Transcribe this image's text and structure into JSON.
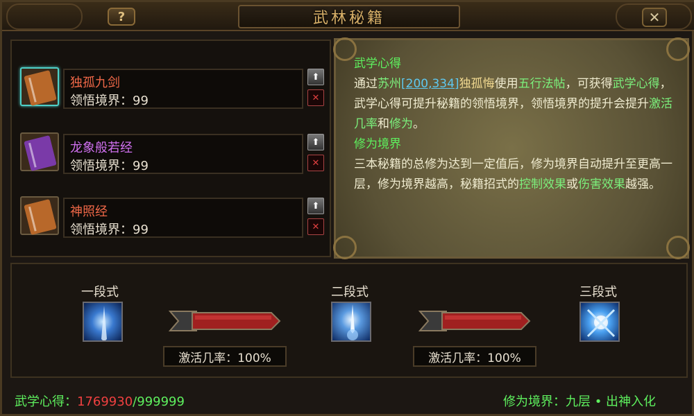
{
  "window": {
    "title": "武林秘籍",
    "help_label": "?",
    "close_label": "✕"
  },
  "books": [
    {
      "name": "独孤九剑",
      "name_color": "#f06848",
      "level_label": "领悟境界：99",
      "cover_color": "#b8682a",
      "selected": true
    },
    {
      "name": "龙象般若经",
      "name_color": "#d070f0",
      "level_label": "领悟境界：99",
      "cover_color": "#7a3aa8",
      "selected": false
    },
    {
      "name": "神照经",
      "name_color": "#f06848",
      "level_label": "领悟境界：99",
      "cover_color": "#b8682a",
      "selected": false
    }
  ],
  "book_controls": {
    "up_label": "⬆",
    "delete_label": "✕"
  },
  "description": {
    "heading1": "武学心得",
    "p1_a": "通过",
    "p1_place": "苏州",
    "p1_coord": "[200,334]",
    "p1_npc": "独孤悔",
    "p1_b": "使用",
    "p1_item": "五行法帖",
    "p1_c": "，可获得",
    "p1_d": "武学心得",
    "p1_e": "，武学心得可提升秘籍的领悟境界，领悟境界的提升会提升",
    "p1_f": "激活几率",
    "p1_g": "和",
    "p1_h": "修为",
    "p1_i": "。",
    "heading2": "修为境界",
    "p2_a": "三本秘籍的总修为达到一定值后，修为境界自动提升至更高一层，修为境界越高，秘籍招式的",
    "p2_b": "控制效果",
    "p2_c": "或",
    "p2_d": "伤害效果",
    "p2_e": "越强。"
  },
  "stages": [
    {
      "label": "一段式"
    },
    {
      "label": "二段式"
    },
    {
      "label": "三段式"
    }
  ],
  "rates": [
    {
      "label": "激活几率：100%"
    },
    {
      "label": "激活几率：100%"
    }
  ],
  "footer": {
    "exp_label": "武学心得：",
    "exp_current": "1769930",
    "exp_max": "/999999",
    "realm_label": "修为境界：九层 • 出神入化"
  }
}
